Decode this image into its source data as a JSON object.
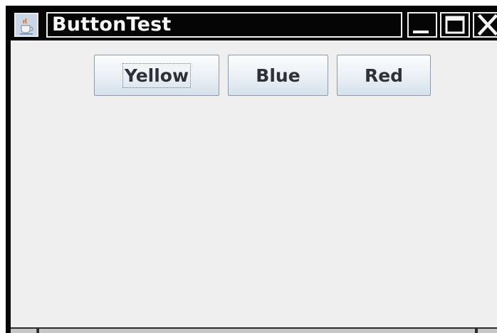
{
  "window": {
    "title": "ButtonTest"
  },
  "buttons": [
    {
      "label": "Yellow"
    },
    {
      "label": "Blue"
    },
    {
      "label": "Red"
    }
  ],
  "colors": {
    "titlebar": "#050505",
    "title_text": "#f7f7f7",
    "content_bg": "#efefef",
    "button_text": "#2f3136"
  },
  "icons": {
    "app": "java-app-icon",
    "minimize": "minimize-icon",
    "maximize": "maximize-icon",
    "close": "close-icon"
  }
}
